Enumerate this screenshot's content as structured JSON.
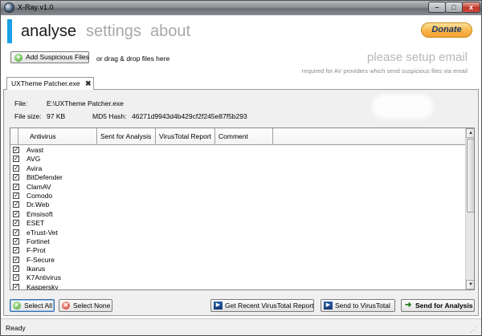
{
  "window": {
    "title": "X-Ray v1.0",
    "minimize_glyph": "–",
    "maximize_glyph": "□",
    "close_glyph": "x"
  },
  "nav": {
    "tabs": [
      "analyse",
      "settings",
      "about"
    ],
    "active_tab": "analyse",
    "accent_color": "#1aa1e6"
  },
  "donate": {
    "label": "Donate"
  },
  "toolbar": {
    "add_button_label": "Add Suspicious Files",
    "drag_hint": "or drag & drop files here"
  },
  "email_notice": {
    "title": "please setup email",
    "subtitle": "required for AV providers which send suspicious files via email"
  },
  "document_tab": {
    "label": "UXTheme Patcher.exe",
    "close_glyph": "✖"
  },
  "file_info": {
    "file_label": "File:",
    "file_value": "E:\\UXTheme Patcher.exe",
    "size_label": "File size:",
    "size_value": "97 KB",
    "md5_label": "MD5 Hash:",
    "md5_value": "46271d9943d4b429cf2f245e87f5b293"
  },
  "grid": {
    "columns": [
      "Antivirus",
      "Sent for Analysis",
      "VirusTotal Report",
      "Comment"
    ],
    "rows": [
      {
        "name": "Avast",
        "checked": true
      },
      {
        "name": "AVG",
        "checked": true
      },
      {
        "name": "Avira",
        "checked": true
      },
      {
        "name": "BitDefender",
        "checked": true
      },
      {
        "name": "ClamAV",
        "checked": true
      },
      {
        "name": "Comodo",
        "checked": true
      },
      {
        "name": "Dr.Web",
        "checked": true
      },
      {
        "name": "Emsisoft",
        "checked": true
      },
      {
        "name": "ESET",
        "checked": true
      },
      {
        "name": "eTrust-Vet",
        "checked": true
      },
      {
        "name": "Fortinet",
        "checked": true
      },
      {
        "name": "F-Prot",
        "checked": true
      },
      {
        "name": "F-Secure",
        "checked": true
      },
      {
        "name": "Ikarus",
        "checked": true
      },
      {
        "name": "K7Antivirus",
        "checked": true
      },
      {
        "name": "Kaspersky",
        "checked": true
      }
    ]
  },
  "buttons": {
    "select_all": "Select All",
    "select_none": "Select None",
    "recent_report": "Get Recent VirusTotal Report",
    "send_vt": "Send to VirusTotal",
    "send_analysis": "Send for Analysis"
  },
  "status": {
    "text": "Ready"
  }
}
